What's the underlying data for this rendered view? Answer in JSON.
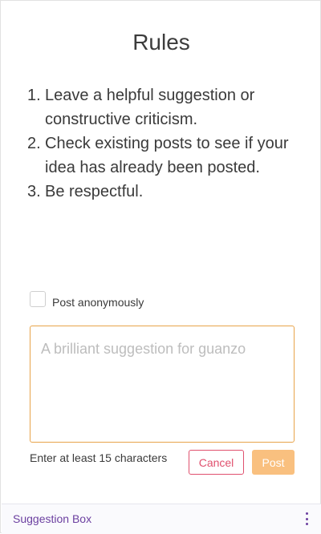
{
  "title": "Rules",
  "rules": [
    {
      "num": "1.",
      "text": "Leave a helpful suggestion or constructive criticism."
    },
    {
      "num": "2.",
      "text": "Check existing posts to see if your idea has already been posted."
    },
    {
      "num": "3.",
      "text": "Be respectful."
    }
  ],
  "anonymous": {
    "label": "Post anonymously",
    "checked": false
  },
  "suggestion": {
    "placeholder": "A brilliant suggestion for guanzo",
    "value": ""
  },
  "hint": "Enter at least 15 characters",
  "buttons": {
    "cancel": "Cancel",
    "post": "Post"
  },
  "footer": {
    "title": "Suggestion Box",
    "menu_icon": "kebab-menu-icon"
  },
  "colors": {
    "accent": "#e8a44a",
    "cancel": "#e0506e",
    "post_disabled": "#f9c07f",
    "footer_text": "#6b3fa0"
  }
}
